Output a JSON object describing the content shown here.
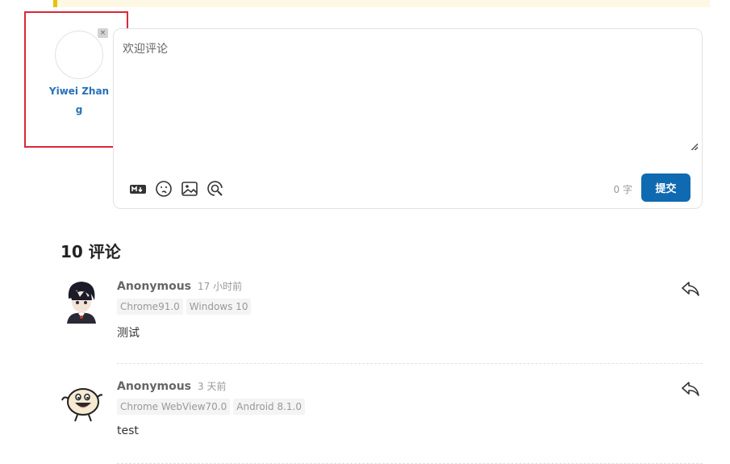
{
  "editor": {
    "placeholder": "欢迎评论",
    "word_count": "0 字",
    "submit_label": "提交",
    "toolbar_icons": [
      "markdown-icon",
      "emoji-icon",
      "image-icon",
      "preview-icon"
    ]
  },
  "login": {
    "name": "Yiwei Zhang",
    "close_glyph": "×"
  },
  "comments": {
    "title": "10 评论",
    "items": [
      {
        "nick": "Anonymous",
        "time": "17 小时前",
        "browser": "Chrome91.0",
        "os": "Windows 10",
        "content": "测试"
      },
      {
        "nick": "Anonymous",
        "time": "3 天前",
        "browser": "Chrome WebView70.0",
        "os": "Android 8.1.0",
        "content": "test"
      }
    ]
  },
  "colors": {
    "accent": "#106ab1",
    "link": "#2770b7",
    "highlight": "#d9283a",
    "notice_border": "#e8c200"
  }
}
